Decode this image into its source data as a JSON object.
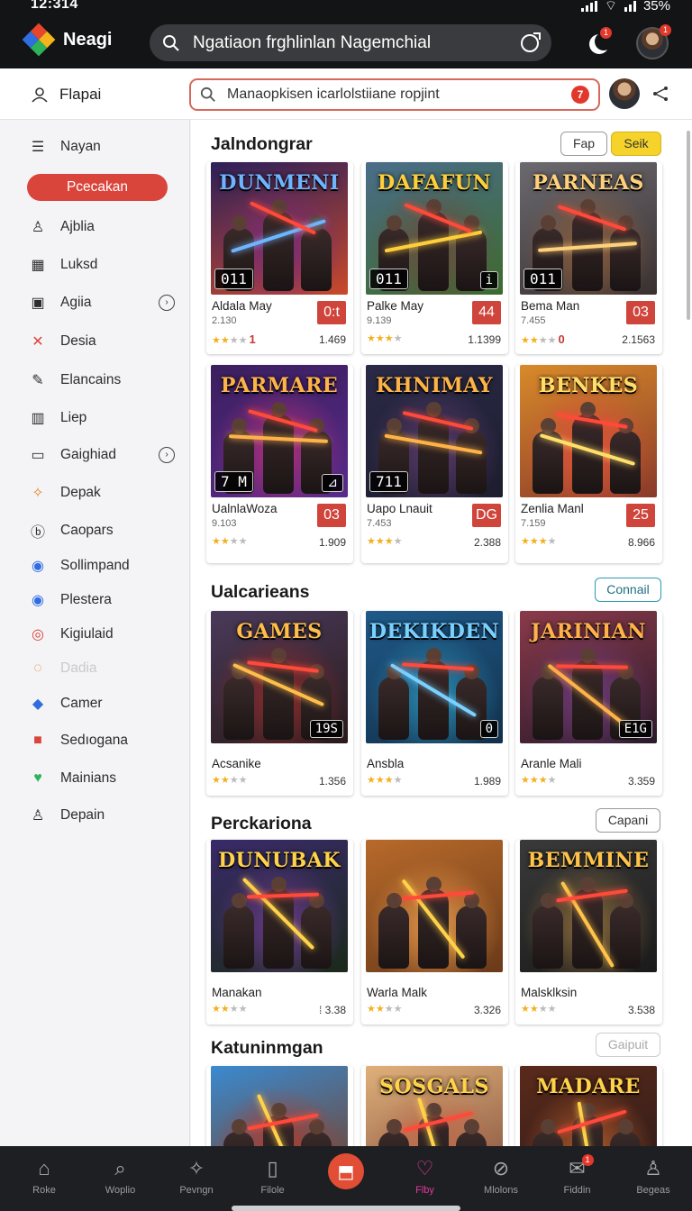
{
  "status": {
    "time": "12:314",
    "battery": "35%"
  },
  "header": {
    "brand": "Neagi",
    "search_query": "Ngatiaon frghlinlan Nagemchial",
    "notif_count": "1",
    "avatar_badge": "1"
  },
  "subheader": {
    "title": "Flapai",
    "search_text": "Manaopkisen icarlolstiiane ropjint",
    "search_count": "7"
  },
  "sidebar": {
    "items": [
      {
        "label": "Nayan",
        "icon": "list-icon"
      },
      {
        "label": "Pcecakan",
        "icon": "",
        "active": true
      },
      {
        "label": "Ajblia",
        "icon": "person-icon"
      },
      {
        "label": "Luksd",
        "icon": "calendar-icon"
      },
      {
        "label": "Agiia",
        "icon": "image-icon",
        "chevron": true
      },
      {
        "label": "Desia",
        "icon": "tools-icon"
      },
      {
        "label": "Elancains",
        "icon": "pencil-icon"
      },
      {
        "label": "Liep",
        "icon": "book-icon"
      },
      {
        "label": "Gaighiad",
        "icon": "panel-icon",
        "chevron": true
      },
      {
        "label": "Depak",
        "icon": "wand-icon"
      },
      {
        "label": "Caopars",
        "icon": "circle-b-icon"
      },
      {
        "label": "Sollimpand",
        "icon": "chart-circle-icon"
      },
      {
        "label": "Plestera",
        "icon": "chart-circle-icon"
      },
      {
        "label": "Kigiulaid",
        "icon": "pin-icon"
      },
      {
        "label": "Dadia",
        "icon": "spinner-icon",
        "faded": true
      },
      {
        "label": "Camer",
        "icon": "gamepad-icon"
      },
      {
        "label": "Sedıogana",
        "icon": "mail-icon"
      },
      {
        "label": "Mainians",
        "icon": "heart-icon"
      },
      {
        "label": "Depain",
        "icon": "person-icon"
      }
    ]
  },
  "sections": [
    {
      "title": "Jalndongrar",
      "buttons": [
        "Fap",
        "Seik"
      ],
      "cards": [
        {
          "art_title": "DUNMENI",
          "overlay": "011",
          "name": "Aldala May",
          "sub": "2.130",
          "badge": "0:t",
          "rating": 2,
          "rating_num": "1",
          "count": "1.469",
          "palette": [
            "#2b1f5a",
            "#7a2a7a",
            "#c94a2a"
          ],
          "title_color": "#6db6ff"
        },
        {
          "art_title": "DAFAFUN",
          "overlay": "011",
          "overlay_r": "i",
          "name": "Palke May",
          "sub": "9.139",
          "badge": "44",
          "rating": 3,
          "count": "1.1399",
          "palette": [
            "#4a6d8a",
            "#6b4a3a",
            "#3d6b2c"
          ],
          "title_color": "#ffcf3a"
        },
        {
          "art_title": "PARNEAS",
          "overlay": "011",
          "name": "Bema Man",
          "sub": "7.455",
          "badge": "03",
          "rating": 2,
          "rating_num": "0",
          "count": "2.1563",
          "palette": [
            "#6b6a70",
            "#8a5c3a",
            "#3a3030"
          ],
          "title_color": "#ffd17a"
        }
      ]
    },
    {
      "title": "",
      "cards": [
        {
          "art_title": "PARMARE",
          "overlay": "7 M",
          "overlay_r": "⊿",
          "name": "UalnlaWoza",
          "sub": "9.103",
          "badge": "03",
          "rating": 2,
          "count": "1.909",
          "palette": [
            "#3a1f5e",
            "#b0307a",
            "#5a2a8a"
          ],
          "title_color": "#ffb24a"
        },
        {
          "art_title": "KHNIMAY",
          "overlay": "711",
          "name": "Uapo Lnauit",
          "sub": "7.453",
          "badge": "DG",
          "rating": 3,
          "count": "2.388",
          "palette": [
            "#2a2a48",
            "#5a3a6a",
            "#1d1d2e"
          ],
          "title_color": "#ffb347"
        },
        {
          "art_title": "BENKES",
          "overlay": "",
          "name": "Zenlia Manl",
          "sub": "7.159",
          "badge": "25",
          "rating": 3,
          "count": "8.966",
          "palette": [
            "#d88a2a",
            "#e0503a",
            "#8a3a2a"
          ],
          "title_color": "#ffdf6a"
        }
      ]
    },
    {
      "title": "Ualcarieans",
      "buttons": [
        "Connail"
      ],
      "cards": [
        {
          "art_title": "GAMES",
          "overlay_r": "19S",
          "name": "Acsanike",
          "rating": 2,
          "count": "1.356",
          "palette": [
            "#4a3a5a",
            "#8a2a2a",
            "#2a1a1a"
          ],
          "title_color": "#ffbe4a"
        },
        {
          "art_title": "DEKIKDEN",
          "overlay_r": "0",
          "name": "Ansbla",
          "rating": 3,
          "count": "1.989",
          "palette": [
            "#1f5a8a",
            "#2a8ab0",
            "#12304a"
          ],
          "title_color": "#7ad0ff"
        },
        {
          "art_title": "JARINIAN",
          "overlay_r": "E1G",
          "name": "Aranle Mali",
          "rating": 3,
          "count": "3.359",
          "palette": [
            "#8a3a4a",
            "#6a3a7a",
            "#2a1a2a"
          ],
          "title_color": "#ffb24a"
        }
      ]
    },
    {
      "title": "Perckariona",
      "buttons": [
        "Capani"
      ],
      "cards": [
        {
          "art_title": "DUNUBAK",
          "name": "Manakan",
          "rating": 2,
          "count": "3.38",
          "count_prefix": "⁞",
          "palette": [
            "#3a2a6a",
            "#6a3a8a",
            "#1a2a1a"
          ],
          "title_color": "#ffd24a"
        },
        {
          "art_title": "",
          "name": "Warla Malk",
          "rating": 2,
          "count": "3.326",
          "palette": [
            "#b86a2a",
            "#e0964a",
            "#6a3a1a"
          ],
          "title_color": "#ffd24a"
        },
        {
          "art_title": "BEMMINE",
          "name": "Malsklksin",
          "rating": 2,
          "count": "3.538",
          "palette": [
            "#3a3a3a",
            "#8a6a3a",
            "#1a1a1a"
          ],
          "title_color": "#ffc34a"
        }
      ]
    },
    {
      "title": "Katuninmgan",
      "buttons": [
        "Gaipuit"
      ],
      "cards": [
        {
          "art_title": "",
          "palette": [
            "#3a8ad0",
            "#b03a2a",
            "#7a3a1a"
          ],
          "title_color": "#ffd24a"
        },
        {
          "art_title": "SOSGALS",
          "palette": [
            "#e0b07a",
            "#c06a4a",
            "#7a4a3a"
          ],
          "title_color": "#ffd24a"
        },
        {
          "art_title": "MADARE",
          "palette": [
            "#5a2a1a",
            "#b05a2a",
            "#2a1a1a"
          ],
          "title_color": "#ffd24a"
        }
      ]
    }
  ],
  "bottom_nav": [
    {
      "label": "Roke",
      "icon": "home-icon"
    },
    {
      "label": "Woplio",
      "icon": "search-icon"
    },
    {
      "label": "Pevngn",
      "icon": "compass-icon"
    },
    {
      "label": "Filole",
      "icon": "file-icon"
    },
    {
      "label": "",
      "icon": "bookmark-icon",
      "center": true
    },
    {
      "label": "Flby",
      "icon": "heart-icon",
      "active": true
    },
    {
      "label": "Mlolons",
      "icon": "explore-icon"
    },
    {
      "label": "Fiddin",
      "icon": "mail-icon",
      "badge": "1"
    },
    {
      "label": "Begeas",
      "icon": "person-icon"
    }
  ]
}
